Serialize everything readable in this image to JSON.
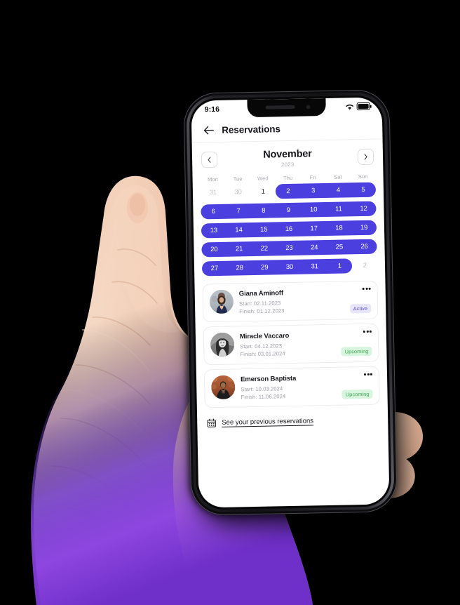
{
  "status_bar": {
    "time": "9:16",
    "wifi_icon": "wifi-icon",
    "battery_icon": "battery-full-icon"
  },
  "app_header": {
    "back_icon": "back-arrow-icon",
    "title": "Reservations"
  },
  "month_nav": {
    "prev_icon": "chevron-left-icon",
    "next_icon": "chevron-right-icon",
    "month": "November",
    "year": "2023"
  },
  "calendar": {
    "weekday_labels": [
      "Mon",
      "Tue",
      "Wed",
      "Thu",
      "Fri",
      "Sat",
      "Sun"
    ],
    "selection_color": "#4b3fe0",
    "weeks": [
      {
        "days": [
          {
            "n": "31",
            "state": "out"
          },
          {
            "n": "30",
            "state": "out"
          },
          {
            "n": "1",
            "state": "current"
          },
          {
            "n": "2",
            "state": "selected"
          },
          {
            "n": "3",
            "state": "selected"
          },
          {
            "n": "4",
            "state": "selected"
          },
          {
            "n": "5",
            "state": "selected"
          }
        ]
      },
      {
        "days": [
          {
            "n": "6",
            "state": "selected"
          },
          {
            "n": "7",
            "state": "selected"
          },
          {
            "n": "8",
            "state": "selected"
          },
          {
            "n": "9",
            "state": "selected"
          },
          {
            "n": "10",
            "state": "selected"
          },
          {
            "n": "11",
            "state": "selected"
          },
          {
            "n": "12",
            "state": "selected"
          }
        ]
      },
      {
        "days": [
          {
            "n": "13",
            "state": "selected"
          },
          {
            "n": "14",
            "state": "selected"
          },
          {
            "n": "15",
            "state": "selected"
          },
          {
            "n": "16",
            "state": "selected"
          },
          {
            "n": "17",
            "state": "selected"
          },
          {
            "n": "18",
            "state": "selected"
          },
          {
            "n": "19",
            "state": "selected"
          }
        ]
      },
      {
        "days": [
          {
            "n": "20",
            "state": "selected"
          },
          {
            "n": "21",
            "state": "selected"
          },
          {
            "n": "22",
            "state": "selected"
          },
          {
            "n": "23",
            "state": "selected"
          },
          {
            "n": "24",
            "state": "selected"
          },
          {
            "n": "25",
            "state": "selected"
          },
          {
            "n": "26",
            "state": "selected"
          }
        ]
      },
      {
        "days": [
          {
            "n": "27",
            "state": "selected"
          },
          {
            "n": "28",
            "state": "selected"
          },
          {
            "n": "29",
            "state": "selected"
          },
          {
            "n": "30",
            "state": "selected"
          },
          {
            "n": "31",
            "state": "selected"
          },
          {
            "n": "1",
            "state": "selected"
          },
          {
            "n": "2",
            "state": "out"
          }
        ]
      }
    ]
  },
  "reservations": [
    {
      "name": "Giana Aminoff",
      "start": "Start: 02.11.2023",
      "finish": "Finish: 01.12.2023",
      "status": "Active",
      "status_bg": "#e8e6fb",
      "status_fg": "#5b4fe3",
      "avatar": "avatar-giana",
      "menu_icon": "more-options-icon"
    },
    {
      "name": "Miracle Vaccaro",
      "start": "Start: 04.12.2023",
      "finish": "Finish: 03.01.2024",
      "status": "Upcoming",
      "status_bg": "#d8f5de",
      "status_fg": "#3fa855",
      "avatar": "avatar-miracle",
      "menu_icon": "more-options-icon"
    },
    {
      "name": "Emerson Baptista",
      "start": "Start: 10.03.2024",
      "finish": "Finish: 11.06.2024",
      "status": "Upcoming",
      "status_bg": "#d8f5de",
      "status_fg": "#3fa855",
      "avatar": "avatar-emerson",
      "menu_icon": "more-options-icon"
    }
  ],
  "footer": {
    "icon": "calendar-icon",
    "link_label": "See your previous reservations"
  }
}
